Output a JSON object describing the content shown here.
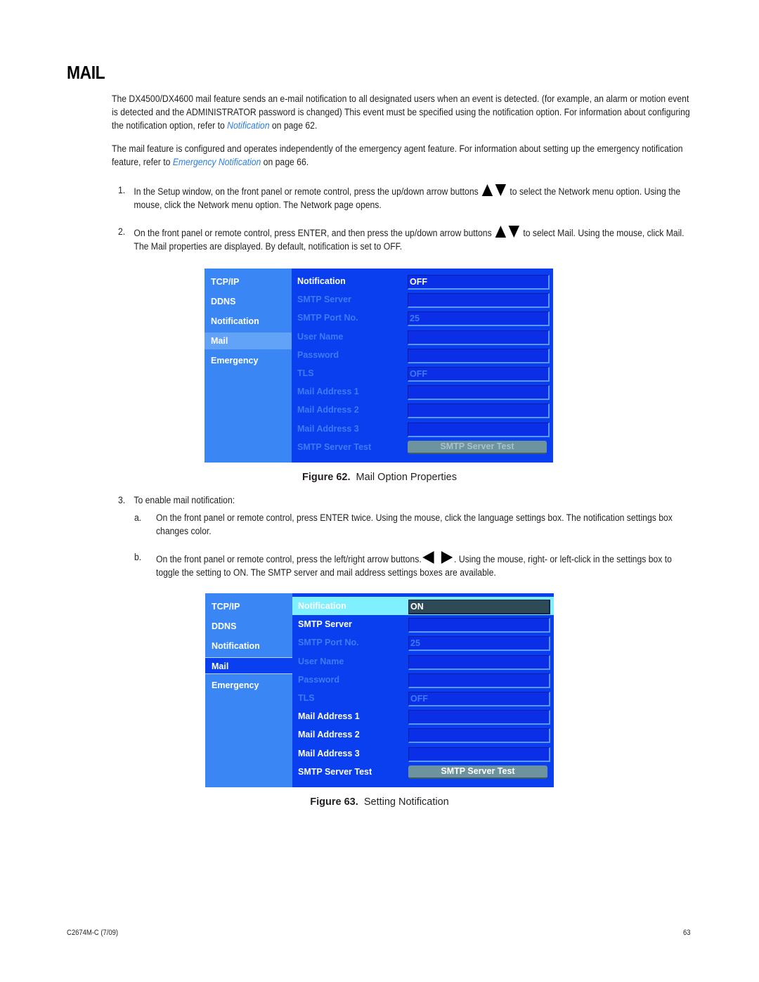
{
  "page": {
    "title": "MAIL",
    "intro_p1": {
      "before": "The DX4500/DX4600 mail feature sends an e-mail notification to all designated users when an event is detected. (for example, an alarm or motion event is detected and the ADMINISTRATOR password is changed) This event must be specified using the notification option. For information about configuring the notification option, refer to ",
      "link": "Notification",
      "after": " on page 62."
    },
    "intro_p2": {
      "before": "The mail feature is configured and operates independently of the emergency agent feature. For information about setting up the emergency notification feature, refer to ",
      "link": "Emergency Notification",
      "after": " on page 66."
    },
    "steps": [
      {
        "num": "1.",
        "before": "In the Setup window, on the front panel or remote control, press the up/down arrow buttons",
        "after": "to select the Network menu option. Using the mouse, click the Network menu option. The Network page opens."
      },
      {
        "num": "2.",
        "before": "On the front panel or remote control, press ENTER, and then press the up/down arrow buttons",
        "after": "to select Mail. Using the mouse, click Mail. The Mail properties are displayed. By default, notification is set to OFF."
      },
      {
        "num": "3.",
        "text": "To enable mail notification:"
      }
    ],
    "substeps": [
      {
        "letter": "a.",
        "text": "On the front panel or remote control, press ENTER twice. Using the mouse, click the language settings box. The notification settings box changes color."
      },
      {
        "letter": "b.",
        "before": "On the front panel or remote control, press the left/right arrow buttons.",
        "after": ". Using the mouse, right- or left-click in the settings box to toggle the setting to ON. The SMTP server and mail address settings boxes are available."
      }
    ],
    "icons": {
      "updown": "up-down-arrow-icons",
      "leftright": "left-right-arrow-icons"
    }
  },
  "figures": [
    {
      "label": "Figure 62.",
      "caption": "Mail Option Properties",
      "sidebar": [
        "TCP/IP",
        "DDNS",
        "Notification",
        "Mail",
        "Emergency"
      ],
      "selected_sidebar": "Mail",
      "rows": [
        {
          "label": "Notification",
          "value": "OFF",
          "enabled": true
        },
        {
          "label": "SMTP Server",
          "value": "",
          "enabled": false
        },
        {
          "label": "SMTP Port No.",
          "value": "25",
          "enabled": false
        },
        {
          "label": "User Name",
          "value": "",
          "enabled": false
        },
        {
          "label": "Password",
          "value": "",
          "enabled": false
        },
        {
          "label": "TLS",
          "value": "OFF",
          "enabled": false
        },
        {
          "label": "Mail Address 1",
          "value": "",
          "enabled": false
        },
        {
          "label": "Mail Address 2",
          "value": "",
          "enabled": false
        },
        {
          "label": "Mail Address 3",
          "value": "",
          "enabled": false
        },
        {
          "label": "SMTP Server Test",
          "button": "SMTP Server Test",
          "enabled": false
        }
      ]
    },
    {
      "label": "Figure 63.",
      "caption": "Setting Notification",
      "sidebar": [
        "TCP/IP",
        "DDNS",
        "Notification",
        "Mail",
        "Emergency"
      ],
      "selected_sidebar": "Mail",
      "rows": [
        {
          "label": "Notification",
          "value": "ON",
          "enabled": true,
          "highlighted": true
        },
        {
          "label": "SMTP Server",
          "value": "",
          "enabled": true
        },
        {
          "label": "SMTP Port No.",
          "value": "25",
          "enabled": false
        },
        {
          "label": "User Name",
          "value": "",
          "enabled": false
        },
        {
          "label": "Password",
          "value": "",
          "enabled": false
        },
        {
          "label": "TLS",
          "value": "OFF",
          "enabled": false
        },
        {
          "label": "Mail Address 1",
          "value": "",
          "enabled": true
        },
        {
          "label": "Mail Address 2",
          "value": "",
          "enabled": true
        },
        {
          "label": "Mail Address 3",
          "value": "",
          "enabled": true
        },
        {
          "label": "SMTP Server Test",
          "button": "SMTP Server Test",
          "enabled": true
        }
      ]
    }
  ],
  "colors": {
    "link": "#2a7de1",
    "panel_bg": "#0a3ff0",
    "sidebar_bg": "#3a86f4",
    "highlight_row": "#7ef0ff",
    "button_bg": "#6d939e"
  },
  "footer": {
    "doc_id": "C2674M-C (7/09)",
    "page_number": "63"
  }
}
